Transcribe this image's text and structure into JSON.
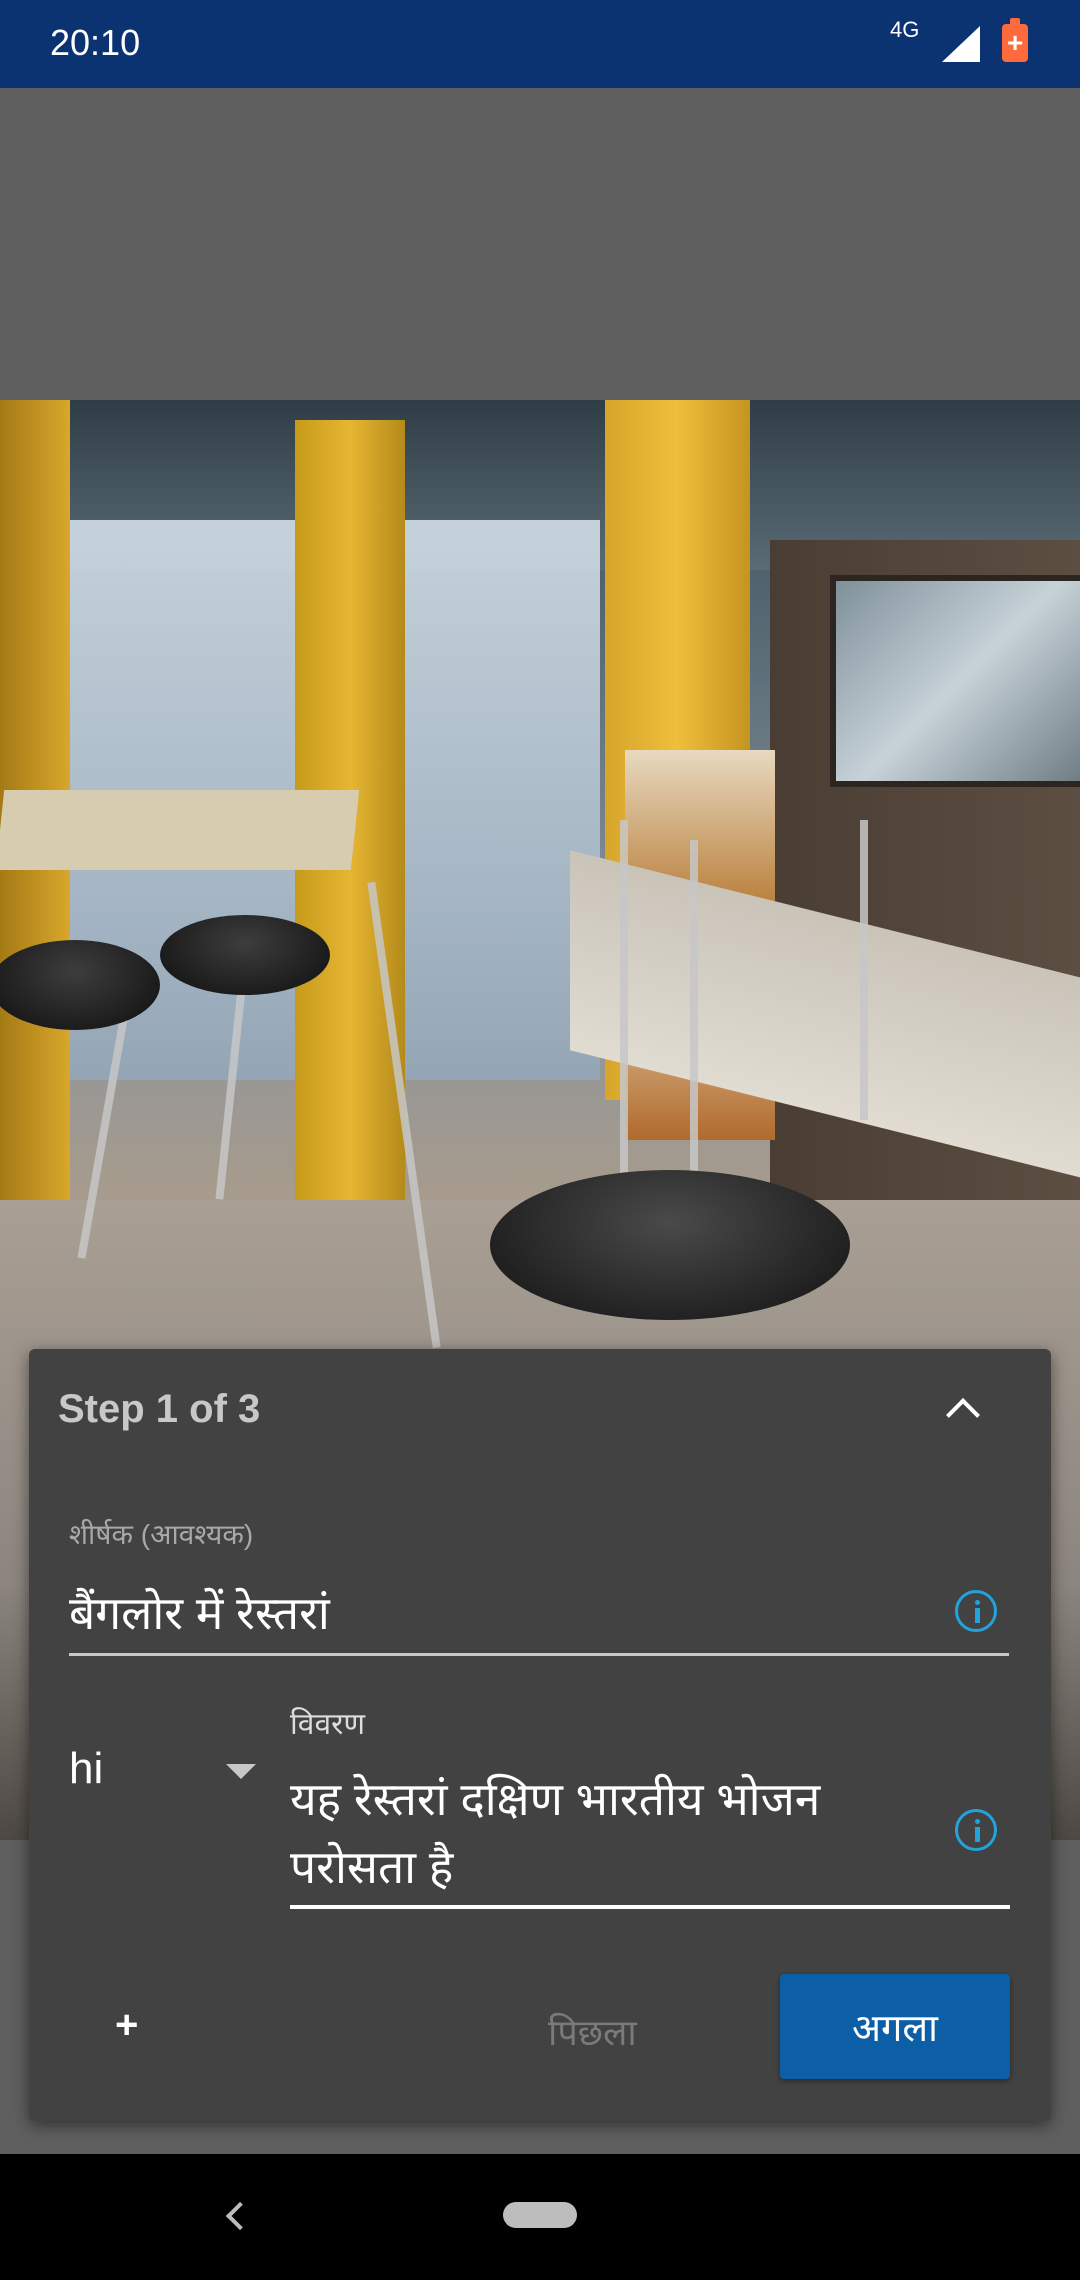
{
  "status_bar": {
    "time": "20:10",
    "network": "4G"
  },
  "photo": {
    "description_icon": "restaurant-photo"
  },
  "panel": {
    "step": "Step 1 of 3",
    "title_label": "शीर्षक (आवश्यक)",
    "title_value": "बैंगलोर में रेस्तरां",
    "language": "hi",
    "description_label": "विवरण",
    "description_value": "यह रेस्तरां दक्षिण भारतीय भोजन परोसता है",
    "add_label": "+",
    "previous_label": "पिछला",
    "next_label": "अगला"
  },
  "colors": {
    "status_bar": "#0b3271",
    "panel": "#424242",
    "accent": "#0c5fa7",
    "info": "#22a3dc"
  }
}
